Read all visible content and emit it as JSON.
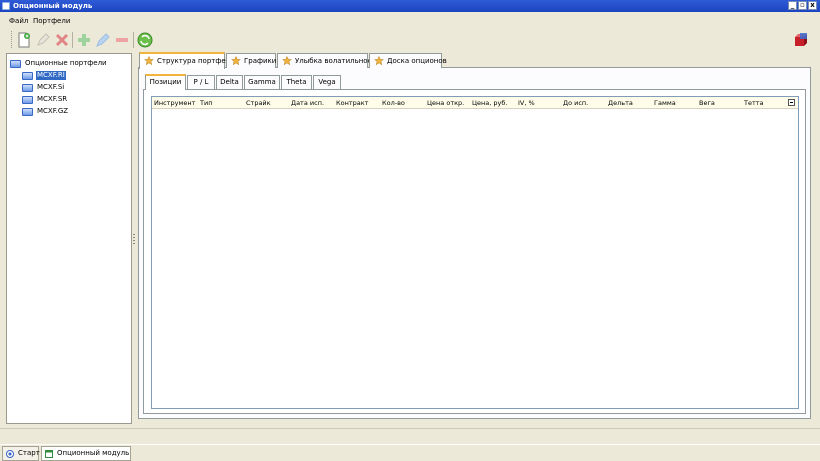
{
  "window": {
    "title": "Опционный модуль",
    "controls": [
      "_",
      "▫",
      "x"
    ]
  },
  "menu": [
    "Файл",
    "Портфели"
  ],
  "toolbar": {
    "icons": [
      "new-document-icon",
      "edit-pencil-icon",
      "delete-x-icon",
      "add-plus-icon",
      "edit-icon",
      "remove-minus-icon",
      "refresh-icon",
      "red-cube-icon"
    ]
  },
  "tree": {
    "root": "Опционные портфели",
    "items": [
      "MCXF.RI",
      "MCXF.Si",
      "MCXF.SR",
      "MCXF.GZ"
    ],
    "selected": "MCXF.RI"
  },
  "tabs": [
    "Структура портфеля",
    "Графики",
    "Улыбка волатильности",
    "Доска опционов"
  ],
  "subtabs": [
    "Позиции",
    "P / L",
    "Delta",
    "Gamma",
    "Theta",
    "Vega"
  ],
  "grid": {
    "columns": [
      "Инструмент",
      "Тип",
      "Страйк",
      "Дата исп.",
      "Контракт",
      "Кол-во",
      "Цена откр.",
      "Цена, руб.",
      "IV, %",
      "До исп.",
      "Дельта",
      "Гамма",
      "Вега",
      "Тетта"
    ]
  },
  "taskbar": [
    "Старт",
    "Опционный модуль"
  ],
  "colors": {
    "titlebar": "#2f5bd6",
    "selection": "#316ac5",
    "active_tab_accent": "#f2b43c",
    "grid_header": "#fffde9"
  }
}
